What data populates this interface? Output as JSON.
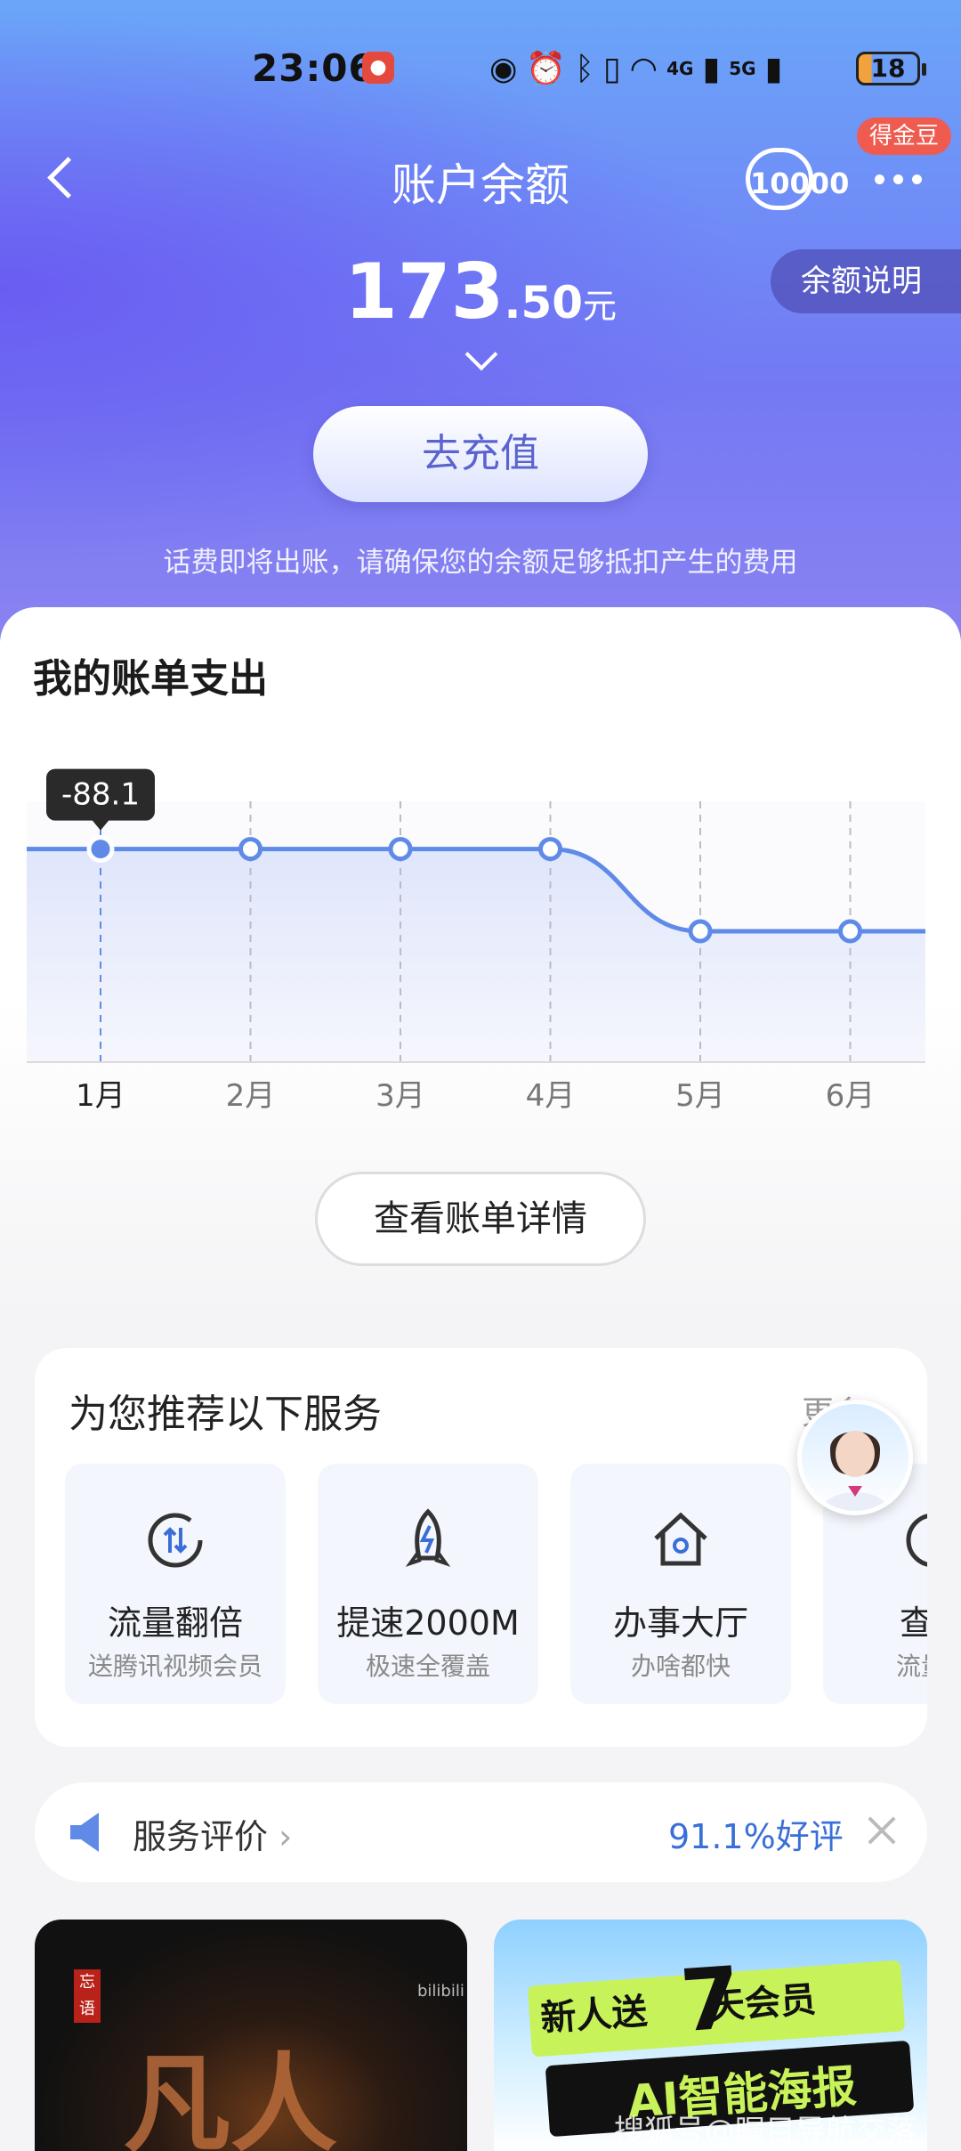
{
  "status_bar": {
    "time": "23:06",
    "battery": "18",
    "net_4g": "4G",
    "net_5g": "5G"
  },
  "header": {
    "title": "账户余额",
    "badge": "得金豆",
    "service_icon_text": "10000",
    "explain": "余额说明"
  },
  "balance": {
    "integer": "173",
    "decimal": ".50",
    "unit": "元"
  },
  "actions": {
    "recharge": "去充值",
    "notice": "话费即将出账，请确保您的余额足够抵扣产生的费用"
  },
  "bill_section": {
    "title": "我的账单支出",
    "detail_button": "查看账单详情",
    "chart_data": {
      "type": "area",
      "categories": [
        "1月",
        "2月",
        "3月",
        "4月",
        "5月",
        "6月"
      ],
      "values": [
        -88.1,
        -88.1,
        -88.1,
        -88.1,
        -98.0,
        -98.0
      ],
      "selected_index": 0,
      "selected_label": "-88.1",
      "grid": "vertical-dashed",
      "line_color": "#5f8ae8"
    }
  },
  "recommend": {
    "title": "为您推荐以下服务",
    "more": "更多",
    "items": [
      {
        "name": "流量翻倍",
        "sub": "送腾讯视频会员",
        "icon": "data-swap-icon"
      },
      {
        "name": "提速2000M",
        "sub": "极速全覆盖",
        "icon": "rocket-icon"
      },
      {
        "name": "办事大厅",
        "sub": "办啥都快",
        "icon": "home-icon"
      },
      {
        "name": "查询",
        "sub": "流量清",
        "icon": "query-icon"
      }
    ]
  },
  "evaluation": {
    "label": "服务评价",
    "rate": "91.1%好评"
  },
  "banners": {
    "left": {
      "seal": "忘语",
      "logo": "bilibili"
    },
    "right": {
      "line1": "新人送",
      "seven": "7",
      "line1b": "天会员",
      "line2": "AI智能海报"
    }
  },
  "watermark": "搜狐号@瞩目导航交落",
  "colors": {
    "accent": "#3a6fd8",
    "brand_gradient_top": "#6aa6f8",
    "brand_gradient_bottom": "#8a82f2",
    "badge_red": "#f05b4f"
  }
}
